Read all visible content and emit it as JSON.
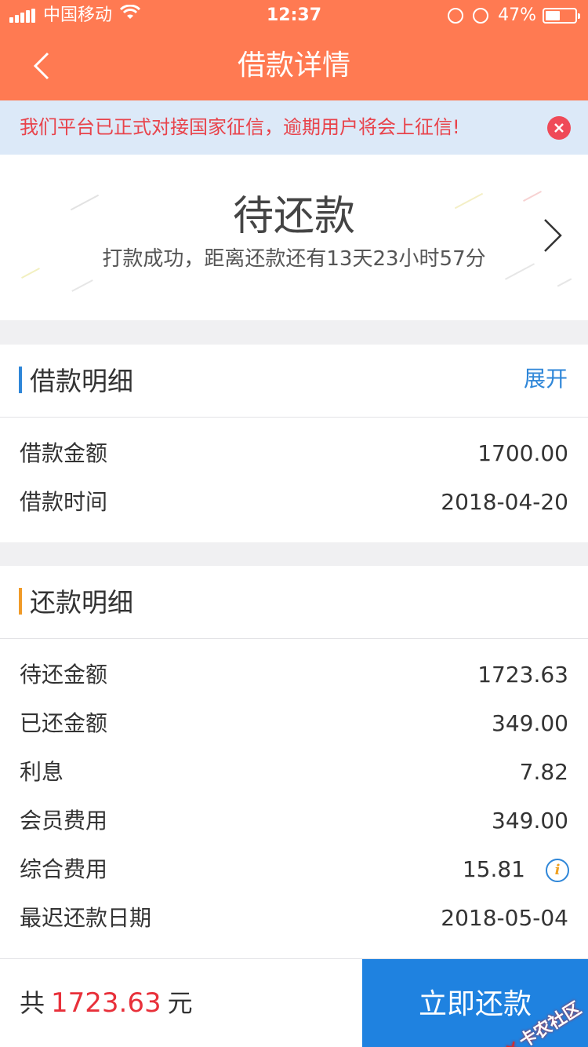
{
  "statusbar": {
    "carrier": "中国移动",
    "time": "12:37",
    "battery": "47%",
    "battery_level": 0.47
  },
  "nav": {
    "title": "借款详情",
    "back_icon": "chevron-left-icon"
  },
  "notice": {
    "text": "我们平台已正式对接国家征信，逾期用户将会上征信!",
    "close_icon": "close-circle-icon"
  },
  "loan_status": {
    "title": "待还款",
    "subtitle": "打款成功，距离还款还有13天23小时57分"
  },
  "loan_detail": {
    "title": "借款明细",
    "action": "展开",
    "rows": [
      {
        "label": "借款金额",
        "value": "1700.00"
      },
      {
        "label": "借款时间",
        "value": "2018-04-20"
      }
    ]
  },
  "repay_detail": {
    "title": "还款明细",
    "rows": [
      {
        "label": "待还金额",
        "value": "1723.63"
      },
      {
        "label": "已还金额",
        "value": "349.00"
      },
      {
        "label": "利息",
        "value": "7.82"
      },
      {
        "label": "会员费用",
        "value": "349.00"
      },
      {
        "label": "综合费用",
        "value": "15.81"
      },
      {
        "label": "最迟还款日期",
        "value": "2018-05-04"
      }
    ],
    "info_icon": "i"
  },
  "footer": {
    "total_prefix": "共",
    "total_amount": "1723.63",
    "total_suffix": "元",
    "pay_button": "立即还款",
    "watermark": "卡农社区"
  },
  "colors": {
    "brand": "#ff7a52",
    "blue": "#1f82e0",
    "red": "#e8303a",
    "section_bar_loan": "#2e86d8",
    "section_bar_repay": "#f09a28"
  }
}
